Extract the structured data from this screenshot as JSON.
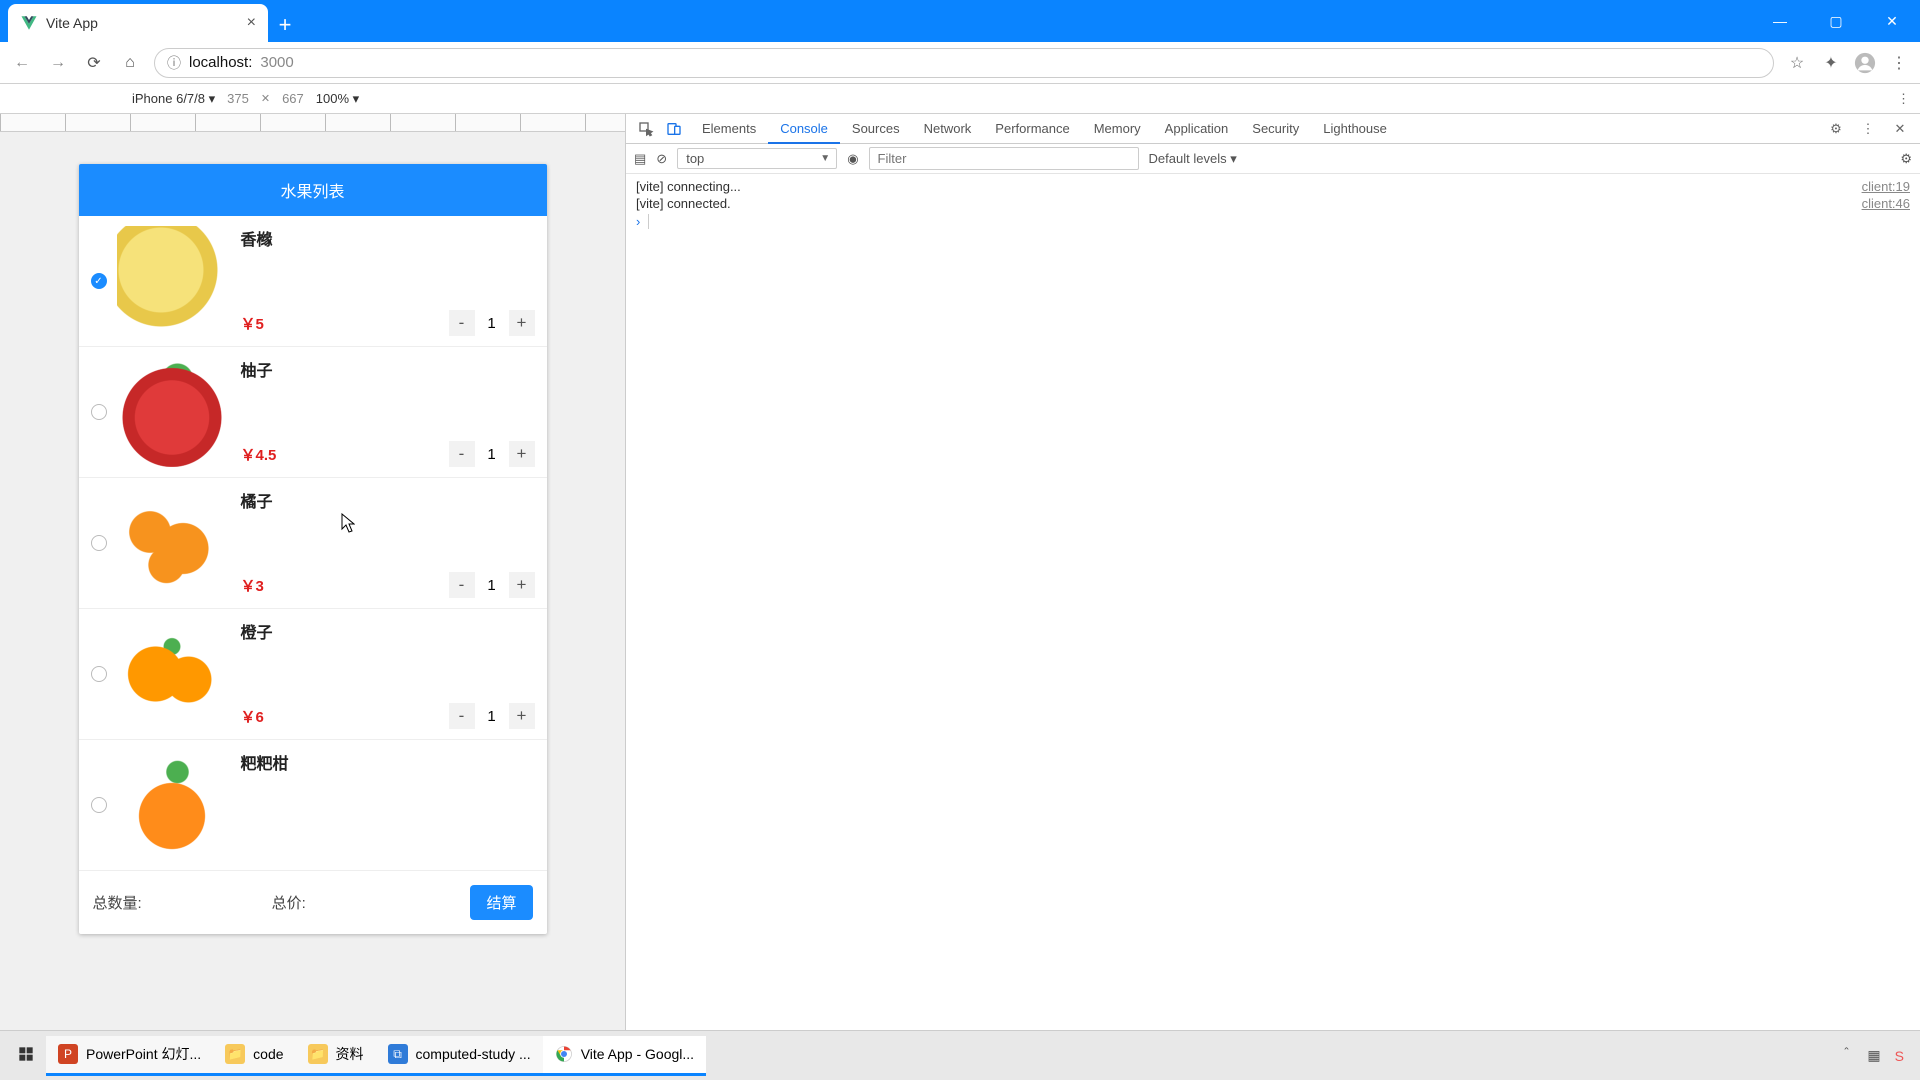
{
  "browser": {
    "tab_title": "Vite App",
    "url_host": "localhost:",
    "url_port": "3000"
  },
  "device_bar": {
    "device": "iPhone 6/7/8 ▾",
    "width": "375",
    "height": "667",
    "zoom": "100% ▾"
  },
  "app": {
    "header": "水果列表",
    "items": [
      {
        "name": "香橼",
        "price": "￥5",
        "qty": "1",
        "checked": true
      },
      {
        "name": "柚子",
        "price": "￥4.5",
        "qty": "1",
        "checked": false
      },
      {
        "name": "橘子",
        "price": "￥3",
        "qty": "1",
        "checked": false
      },
      {
        "name": "橙子",
        "price": "￥6",
        "qty": "1",
        "checked": false
      },
      {
        "name": "粑粑柑",
        "price": "",
        "qty": "",
        "checked": false
      }
    ],
    "total_qty_label": "总数量:",
    "total_price_label": "总价:",
    "checkout": "结算"
  },
  "devtools": {
    "tabs": [
      "Elements",
      "Console",
      "Sources",
      "Network",
      "Performance",
      "Memory",
      "Application",
      "Security",
      "Lighthouse"
    ],
    "active_tab": "Console",
    "context": "top",
    "filter_placeholder": "Filter",
    "levels": "Default levels ▾",
    "logs": [
      {
        "msg": "[vite] connecting...",
        "src": "client:19"
      },
      {
        "msg": "[vite] connected.",
        "src": "client:46"
      }
    ]
  },
  "taskbar": {
    "items": [
      {
        "label": "PowerPoint 幻灯...",
        "icon": "pp",
        "state": "running"
      },
      {
        "label": "code",
        "icon": "fd",
        "state": "running"
      },
      {
        "label": "资料",
        "icon": "fd",
        "state": "running"
      },
      {
        "label": "computed-study ...",
        "icon": "vs",
        "state": "running"
      },
      {
        "label": "Vite App - Googl...",
        "icon": "ch",
        "state": "active"
      }
    ]
  }
}
